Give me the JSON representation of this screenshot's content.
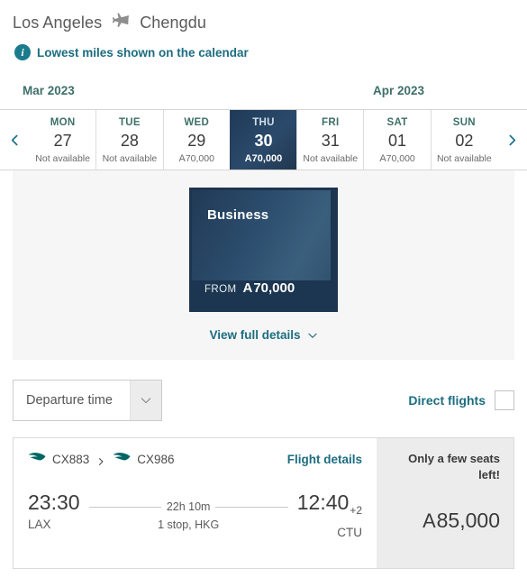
{
  "header": {
    "origin_city": "Los Angeles",
    "destination_city": "Chengdu",
    "plane_icon": "plane-icon"
  },
  "notice": {
    "icon": "info-icon",
    "text": "Lowest miles shown on the calendar"
  },
  "calendar": {
    "prev_icon": "chevron-left-icon",
    "next_icon": "chevron-right-icon",
    "month_left": "Mar 2023",
    "month_right": "Apr 2023",
    "miles_symbol": "A",
    "days": [
      {
        "dow": "MON",
        "date": "27",
        "status": "Not available",
        "miles": null,
        "selected": false
      },
      {
        "dow": "TUE",
        "date": "28",
        "status": "Not available",
        "miles": null,
        "selected": false
      },
      {
        "dow": "WED",
        "date": "29",
        "status": null,
        "miles": "70,000",
        "selected": false
      },
      {
        "dow": "THU",
        "date": "30",
        "status": null,
        "miles": "70,000",
        "selected": true
      },
      {
        "dow": "FRI",
        "date": "31",
        "status": "Not available",
        "miles": null,
        "selected": false
      },
      {
        "dow": "SAT",
        "date": "01",
        "status": null,
        "miles": "70,000",
        "selected": false
      },
      {
        "dow": "SUN",
        "date": "02",
        "status": "Not available",
        "miles": null,
        "selected": false
      }
    ]
  },
  "cabin": {
    "name": "Business",
    "from_label": "FROM",
    "miles_symbol": "A",
    "price": "70,000",
    "view_details_label": "View full details",
    "chevron_icon": "chevron-down-icon"
  },
  "filters": {
    "departure_time_label": "Departure time",
    "dropdown_icon": "chevron-down-icon",
    "direct_flights_label": "Direct flights",
    "direct_flights_checked": false
  },
  "flight": {
    "segments": [
      {
        "airline_icon": "cathay-brushwing-icon",
        "flight_number": "CX883"
      },
      {
        "airline_icon": "cathay-brushwing-icon",
        "flight_number": "CX986"
      }
    ],
    "segment_separator_icon": "chevron-right-icon",
    "details_link": "Flight details",
    "depart_time": "23:30",
    "depart_airport": "LAX",
    "arrive_time": "12:40",
    "arrive_day_offset": "+2",
    "arrive_airport": "CTU",
    "duration": "22h 10m",
    "stops": "1 stop, HKG",
    "seats_notice": "Only a few seats left!",
    "miles_symbol": "A",
    "price": "85,000"
  },
  "colors": {
    "teal_link": "#1c6d80",
    "month_green": "#3d7068",
    "selected_navy": "#2b4a6b",
    "cathay_green": "#006564",
    "panel_gray": "#f6f6f6",
    "price_panel_gray": "#ececec"
  }
}
